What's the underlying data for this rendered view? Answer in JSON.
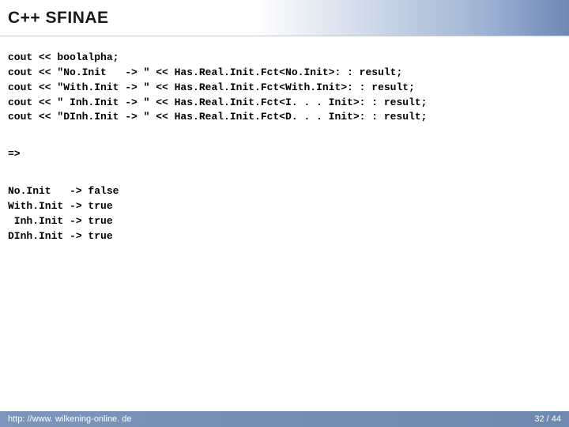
{
  "title": "C++ SFINAE",
  "code_block_1": "cout << boolalpha;\ncout << \"No.Init   -> \" << Has.Real.Init.Fct<No.Init>: : result;\ncout << \"With.Init -> \" << Has.Real.Init.Fct<With.Init>: : result;\ncout << \" Inh.Init -> \" << Has.Real.Init.Fct<I. . . Init>: : result;\ncout << \"DInh.Init -> \" << Has.Real.Init.Fct<D. . . Init>: : result;",
  "code_block_2": "=>",
  "code_block_3": "No.Init   -> false\nWith.Init -> true\n Inh.Init -> true\nDInh.Init -> true",
  "footer": {
    "url": "http: //www. wilkening-online. de",
    "page": "32 / 44"
  }
}
